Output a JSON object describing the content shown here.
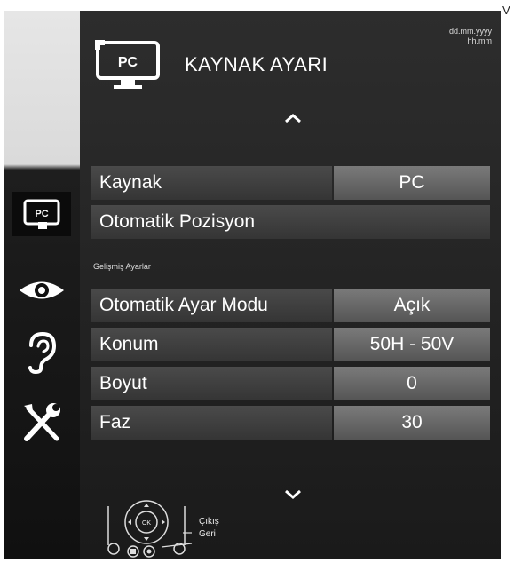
{
  "corner_mark": "V",
  "header": {
    "title": "KAYNAK AYARI",
    "icon_text": "PC",
    "date": "dd.mm.yyyy",
    "time": "hh.mm"
  },
  "sidebar": {
    "items": [
      {
        "icon": "pc-source-icon",
        "text": "PC",
        "active": true
      },
      {
        "icon": "eye-icon"
      },
      {
        "icon": "ear-icon"
      },
      {
        "icon": "tools-icon"
      }
    ]
  },
  "menu": {
    "items": [
      {
        "label": "Kaynak",
        "value": "PC"
      },
      {
        "label": "Otomatik Pozisyon"
      }
    ],
    "advanced_section_label": "Gelişmiş Ayarlar",
    "advanced_items": [
      {
        "label": "Otomatik Ayar Modu",
        "value": "Açık"
      },
      {
        "label": "Konum",
        "value": "50H - 50V"
      },
      {
        "label": "Boyut",
        "value": "0"
      },
      {
        "label": "Faz",
        "value": "30"
      }
    ]
  },
  "footer": {
    "ok_label": "OK",
    "exit_label": "Çıkış",
    "back_label": "Geri"
  },
  "colors": {
    "panel_bg": "#262626",
    "row_label_bg": "#3e3e3e",
    "row_value_bg": "#656565",
    "sidebar_top": "#e0e0e0"
  }
}
